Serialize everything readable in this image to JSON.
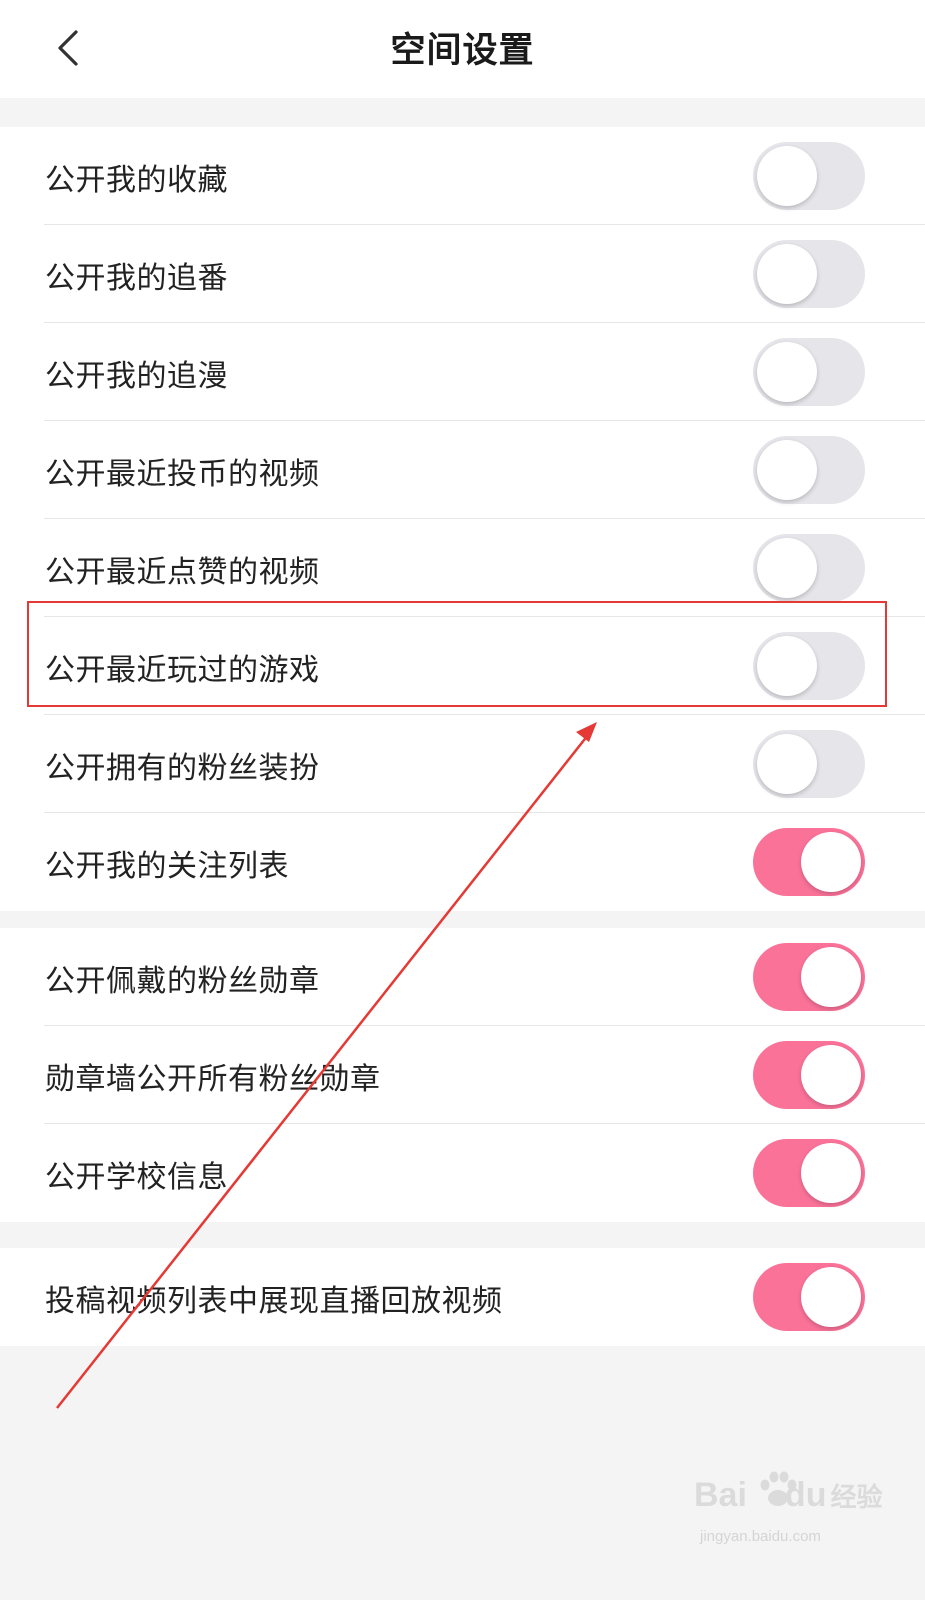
{
  "header": {
    "title": "空间设置"
  },
  "groups": [
    {
      "rows": [
        {
          "label": "公开我的收藏",
          "on": false
        },
        {
          "label": "公开我的追番",
          "on": false
        },
        {
          "label": "公开我的追漫",
          "on": false
        },
        {
          "label": "公开最近投币的视频",
          "on": false
        },
        {
          "label": "公开最近点赞的视频",
          "on": false
        },
        {
          "label": "公开最近玩过的游戏",
          "on": false
        },
        {
          "label": "公开拥有的粉丝装扮",
          "on": false
        },
        {
          "label": "公开我的关注列表",
          "on": true
        }
      ]
    },
    {
      "rows": [
        {
          "label": "公开佩戴的粉丝勋章",
          "on": true
        },
        {
          "label": "勋章墙公开所有粉丝勋章",
          "on": true
        },
        {
          "label": "公开学校信息",
          "on": true
        }
      ]
    },
    {
      "rows": [
        {
          "label": "投稿视频列表中展现直播回放视频",
          "on": true
        }
      ]
    }
  ],
  "colors": {
    "toggle_on": "#fb7299",
    "toggle_off": "#e5e5ea",
    "annotation": "#e53935"
  },
  "watermark": {
    "brand": "Bai",
    "brand2": "du",
    "brand_cn": "经验",
    "url": "jingyan.baidu.com"
  }
}
